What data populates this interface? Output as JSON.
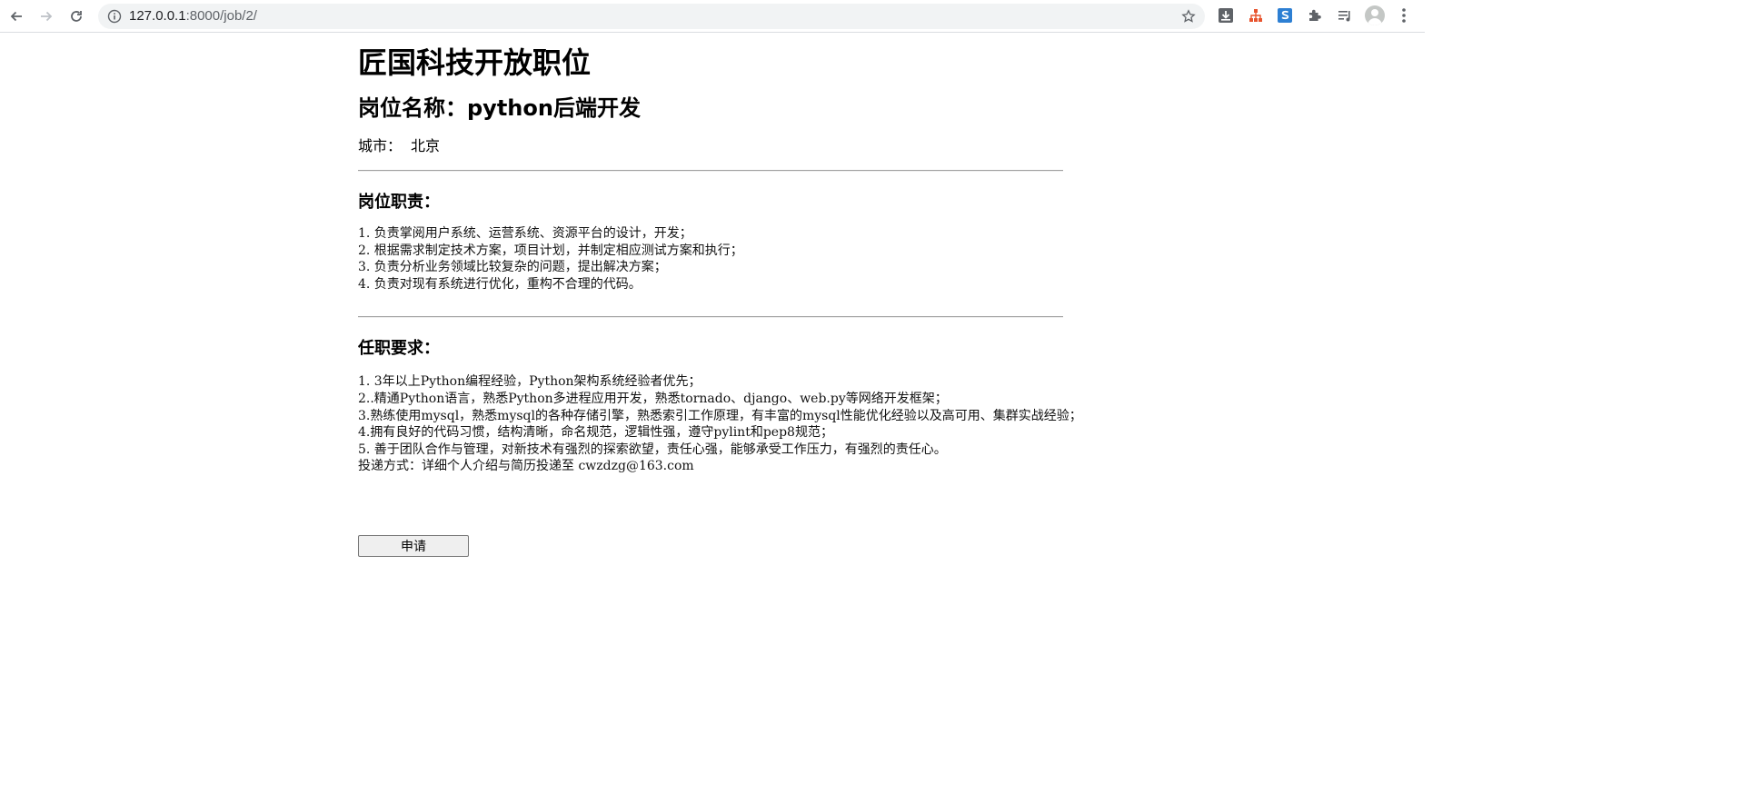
{
  "browser": {
    "url_host": "127.0.0.1",
    "url_rest": ":8000/job/2/",
    "icons": [
      "back-icon",
      "forward-icon",
      "reload-icon",
      "info-icon",
      "bookmark-star-icon",
      "download-extension-icon",
      "tree-extension-icon",
      "s-extension-icon",
      "puzzle-extensions-icon",
      "reading-list-icon",
      "profile-avatar-icon",
      "menu-kebab-icon"
    ]
  },
  "page": {
    "title": "匠国科技开放职位",
    "job_heading": "岗位名称：python后端开发",
    "city_label": "城市：",
    "city_value": "北京",
    "duties_heading": "岗位职责：",
    "duties": [
      "1.  负责掌阅用户系统、运营系统、资源平台的设计，开发；",
      "2.  根据需求制定技术方案，项目计划，并制定相应测试方案和执行；",
      "3.  负责分析业务领域比较复杂的问题，提出解决方案；",
      "4.  负责对现有系统进行优化，重构不合理的代码。"
    ],
    "requirements_heading": "任职要求：",
    "requirements": [
      "1.  3年以上Python编程经验，Python架构系统经验者优先；",
      "2..精通Python语言，熟悉Python多进程应用开发，熟悉tornado、django、web.py等网络开发框架；",
      "3.熟练使用mysql，熟悉mysql的各种存储引擎，熟悉索引工作原理，有丰富的mysql性能优化经验以及高可用、集群实战经验；",
      "4.拥有良好的代码习惯，结构清晰，命名规范，逻辑性强，遵守pylint和pep8规范；",
      "5.  善于团队合作与管理，对新技术有强烈的探索欲望，责任心强，能够承受工作压力，有强烈的责任心。",
      "投递方式：详细个人介绍与简历投递至 cwzdzg@163.com"
    ],
    "apply_label": "申请"
  },
  "colors": {
    "omnibox_bg": "#f1f3f4",
    "toolbar_icon": "#5f6368",
    "tree_extension": "#e8542e",
    "s_extension": "#2d7fd3"
  }
}
